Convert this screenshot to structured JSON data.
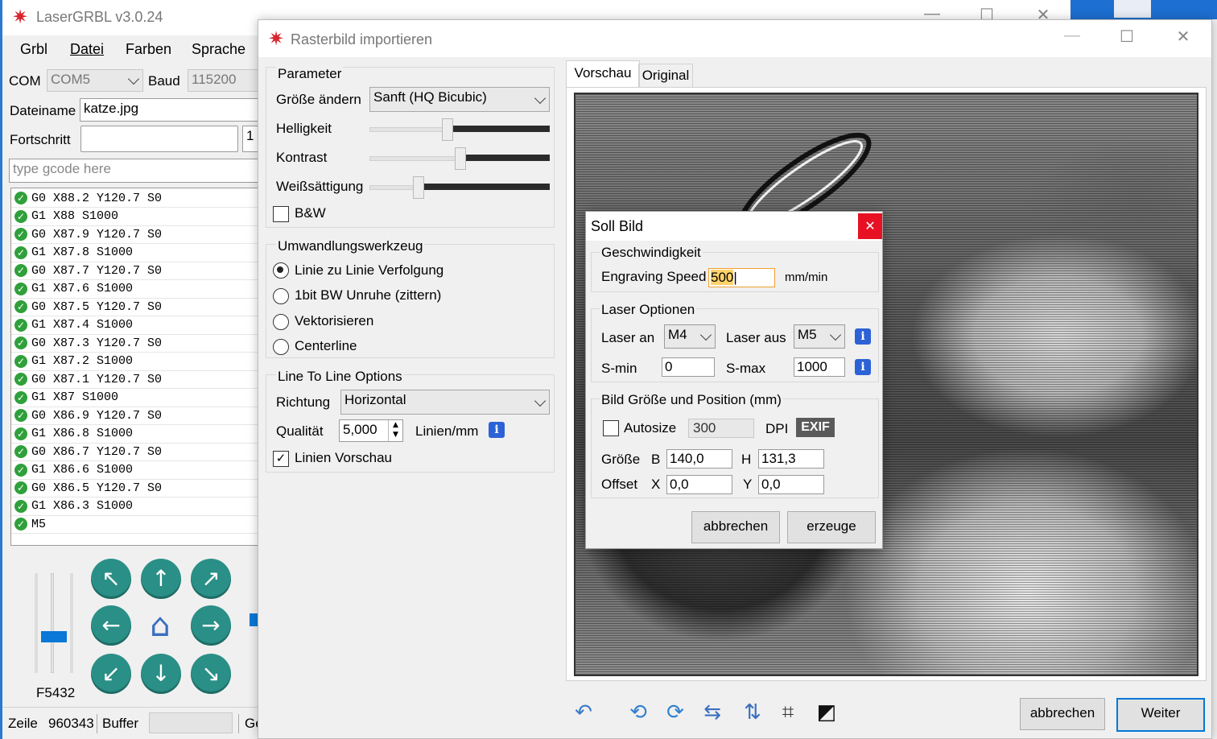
{
  "main_window": {
    "title": "LaserGRBL v3.0.24",
    "menu": [
      "Grbl",
      "Datei",
      "Farben",
      "Sprache"
    ],
    "com_label": "COM",
    "com_value": "COM5",
    "baud_label": "Baud",
    "baud_value": "115200",
    "file_label": "Dateiname",
    "file_value": "katze.jpg",
    "progress_label": "Fortschritt",
    "progress_extra": "1",
    "gcode_placeholder": "type gcode here",
    "gcode_lines": [
      "G0 X88.2 Y120.7 S0",
      "G1 X88 S1000",
      "G0 X87.9 Y120.7 S0",
      "G1 X87.8 S1000",
      "G0 X87.7 Y120.7 S0",
      "G1 X87.6 S1000",
      "G0 X87.5 Y120.7 S0",
      "G1 X87.4 S1000",
      "G0 X87.3 Y120.7 S0",
      "G1 X87.2 S1000",
      "G0 X87.1 Y120.7 S0",
      "G1 X87 S1000",
      "G0 X86.9 Y120.7 S0",
      "G1 X86.8 S1000",
      "G0 X86.7 Y120.7 S0",
      "G1 X86.6 S1000",
      "G0 X86.5 Y120.7 S0",
      "G1 X86.3 S1000",
      "M5"
    ],
    "speed_label": "F5432",
    "status": {
      "line_label": "Zeile",
      "line_value": "960343",
      "buffer_label": "Buffer",
      "ge": "Ge"
    }
  },
  "raster_dialog": {
    "title": "Rasterbild importieren",
    "parameter_group": "Parameter",
    "resize_label": "Größe ändern",
    "resize_value": "Sanft (HQ Bicubic)",
    "brightness_label": "Helligkeit",
    "contrast_label": "Kontrast",
    "whiteclip_label": "Weißsättigung",
    "brightness_level": 0.43,
    "contrast_level": 0.5,
    "whiteclip_level": 0.27,
    "bw_label": "B&W",
    "tool_group": "Umwandlungswerkzeug",
    "tool_options": [
      "Linie zu Linie Verfolgung",
      "1bit BW Unruhe (zittern)",
      "Vektorisieren",
      "Centerline"
    ],
    "line_group": "Line To Line Options",
    "direction_label": "Richtung",
    "direction_value": "Horizontal",
    "quality_label": "Qualität",
    "quality_value": "5,000",
    "quality_unit": "Linien/mm",
    "preview_lines_label": "Linien Vorschau",
    "tabs": [
      "Vorschau",
      "Original"
    ],
    "cancel": "abbrechen",
    "next": "Weiter"
  },
  "target_dialog": {
    "title": "Soll Bild",
    "speed_group": "Geschwindigkeit",
    "speed_label": "Engraving Speed",
    "speed_value": "500",
    "speed_unit": "mm/min",
    "laser_group": "Laser Optionen",
    "laser_on_label": "Laser an",
    "laser_on_value": "M4",
    "laser_off_label": "Laser aus",
    "laser_off_value": "M5",
    "smin_label": "S-min",
    "smin_value": "0",
    "smax_label": "S-max",
    "smax_value": "1000",
    "size_group": "Bild Größe und Position (mm)",
    "autosize_label": "Autosize",
    "dpi_value": "300",
    "dpi_label": "DPI",
    "exif": "EXIF",
    "size_label": "Größe",
    "b_label": "B",
    "b_value": "140,0",
    "h_label": "H",
    "h_value": "131,3",
    "offset_label": "Offset",
    "x_label": "X",
    "x_value": "0,0",
    "y_label": "Y",
    "y_value": "0,0",
    "cancel": "abbrechen",
    "create": "erzeuge"
  },
  "colors": {
    "accent": "#0078d7",
    "close_red": "#e81123",
    "jog_teal": "#2a8f86",
    "ok_green": "#2fa03a",
    "info_blue": "#2d62d6"
  }
}
